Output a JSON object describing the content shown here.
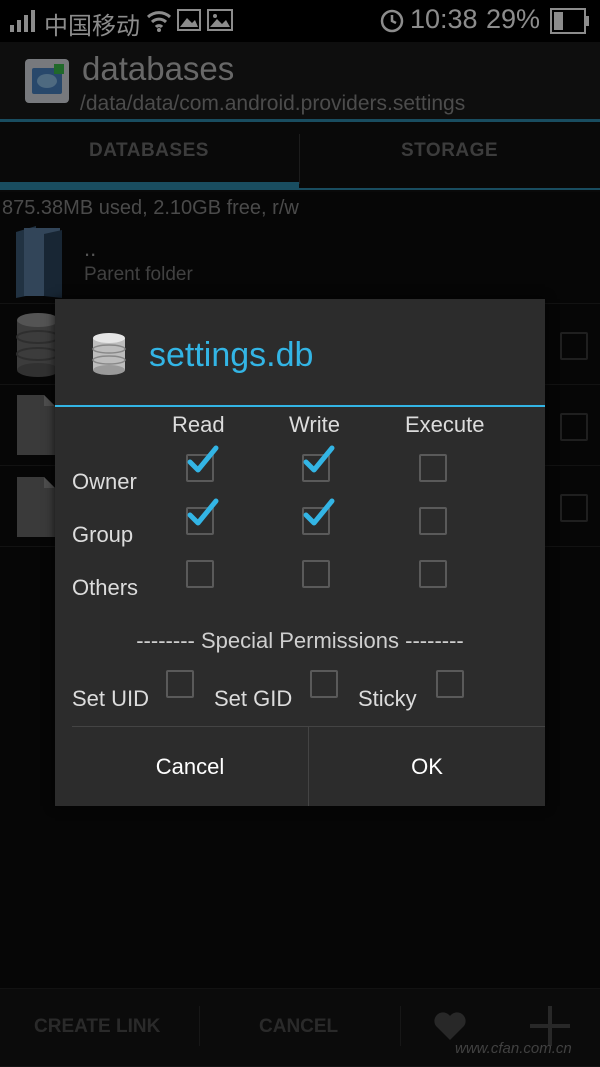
{
  "status_bar": {
    "carrier": "中国移动",
    "time": "10:38",
    "battery": "29%"
  },
  "app_bar": {
    "title": "databases",
    "subtitle": "/data/data/com.android.providers.settings"
  },
  "tabs": [
    {
      "label": "DATABASES",
      "selected": true
    },
    {
      "label": "STORAGE",
      "selected": false
    }
  ],
  "storage_info": "875.38MB used, 2.10GB free, r/w",
  "list": {
    "parent_title": "..",
    "parent_subtitle": "Parent folder"
  },
  "dialog": {
    "title": "settings.db",
    "columns": [
      "Read",
      "Write",
      "Execute"
    ],
    "rows": [
      {
        "label": "Owner",
        "checks": [
          true,
          true,
          false
        ]
      },
      {
        "label": "Group",
        "checks": [
          true,
          true,
          false
        ]
      },
      {
        "label": "Others",
        "checks": [
          false,
          false,
          false
        ]
      }
    ],
    "special_header": "-------- Special Permissions --------",
    "special": [
      {
        "label": "Set UID",
        "checked": false
      },
      {
        "label": "Set GID",
        "checked": false
      },
      {
        "label": "Sticky",
        "checked": false
      }
    ],
    "cancel_label": "Cancel",
    "ok_label": "OK"
  },
  "bottom_bar": {
    "create_link": "CREATE LINK",
    "cancel": "CANCEL"
  },
  "watermark": "www.cfan.com.cn",
  "colors": {
    "accent": "#33b5e5",
    "tab_indicator": "#2f8db0",
    "dialog_bg": "#2c2c2c"
  },
  "icons": [
    "signal-icon",
    "wifi-icon",
    "image-icon",
    "alarm-icon",
    "battery-icon",
    "app-icon",
    "folder-icon",
    "database-icon",
    "file-icon",
    "favorite-icon",
    "add-icon"
  ]
}
